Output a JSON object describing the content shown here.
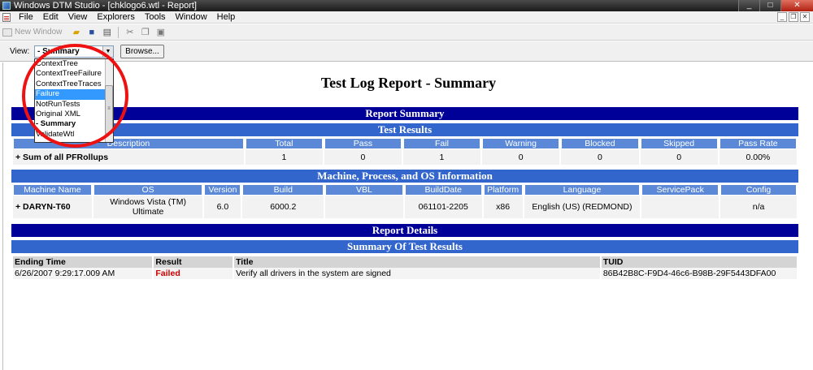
{
  "window": {
    "title": "Windows DTM Studio - [chklogo6.wtl - Report]",
    "buttons": {
      "minimize": "_",
      "maximize": "□",
      "close": "✕"
    }
  },
  "menu": [
    "File",
    "Edit",
    "View",
    "Explorers",
    "Tools",
    "Window",
    "Help"
  ],
  "toolbar": {
    "new_window": "New Window"
  },
  "viewbar": {
    "label": "View:",
    "selected": "- Summary",
    "browse": "Browse..."
  },
  "dropdown": {
    "options": [
      "ContextTree",
      "ContextTreeFailure",
      "ContextTreeTraces",
      "Failure",
      "NotRunTests",
      "Original XML",
      "- Summary",
      "ValidateWtl"
    ],
    "highlighted_index": 3
  },
  "report": {
    "title": "Test Log Report - Summary",
    "report_summary": "Report Summary",
    "test_results": {
      "heading": "Test Results",
      "columns": [
        "Description",
        "Total",
        "Pass",
        "Fail",
        "Warning",
        "Blocked",
        "Skipped",
        "Pass Rate"
      ],
      "rows": [
        [
          "+ Sum of all PFRollups",
          "1",
          "0",
          "1",
          "0",
          "0",
          "0",
          "0.00%"
        ]
      ]
    },
    "machine_info": {
      "heading": "Machine, Process, and OS Information",
      "columns": [
        "Machine Name",
        "OS",
        "Version",
        "Build",
        "VBL",
        "BuildDate",
        "Platform",
        "Language",
        "ServicePack",
        "Config"
      ],
      "rows": [
        [
          "+ DARYN-T60",
          "Windows Vista (TM) Ultimate",
          "6.0",
          "6000.2",
          "",
          "061101-2205",
          "x86",
          "English (US) (REDMOND)",
          "",
          "n/a"
        ]
      ]
    },
    "report_details": "Report Details",
    "summary_of_results": {
      "heading": "Summary Of Test Results",
      "columns": [
        "Ending Time",
        "Result",
        "Title",
        "TUID"
      ],
      "rows": [
        [
          "6/26/2007 9:29:17.009 AM",
          "Failed",
          "Verify all drivers in the system are signed",
          "86B42B8C-F9D4-46c6-B98B-29F5443DFA00"
        ]
      ]
    }
  },
  "colors": {
    "dark_bar": "#000099",
    "mid_bar": "#3366cc",
    "header_cell": "#5b89d8",
    "failed": "#cc0000",
    "annotation": "#ee1111"
  }
}
